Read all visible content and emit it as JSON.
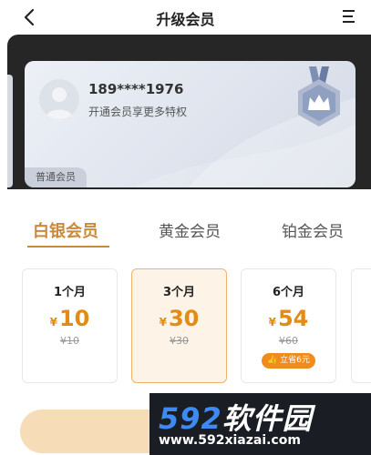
{
  "header": {
    "title": "升级会员",
    "back_icon": "chevron-left-icon",
    "menu_icon": "menu-icon"
  },
  "user_card": {
    "phone": "189****1976",
    "promo_text": "开通会员享更多特权",
    "level_label": "普通会员",
    "avatar_icon": "avatar-placeholder-icon",
    "badge_icon": "crown-medal-icon"
  },
  "tabs": [
    {
      "label": "白银会员",
      "active": true
    },
    {
      "label": "黄金会员",
      "active": false
    },
    {
      "label": "铂金会员",
      "active": false
    }
  ],
  "plans": [
    {
      "duration": "1个月",
      "currency": "¥",
      "price": "10",
      "original": "¥10",
      "selected": false,
      "badge": ""
    },
    {
      "duration": "3个月",
      "currency": "¥",
      "price": "30",
      "original": "¥30",
      "selected": true,
      "badge": ""
    },
    {
      "duration": "6个月",
      "currency": "¥",
      "price": "54",
      "original": "¥60",
      "selected": false,
      "badge": "立省6元"
    }
  ],
  "watermark": {
    "digits": "592",
    "text": "软件园",
    "url": "www.592xiazai.com"
  },
  "colors": {
    "accent": "#c98a3c",
    "price": "#e38b14",
    "badge": "#f08c1e",
    "dark_band": "#262626"
  }
}
